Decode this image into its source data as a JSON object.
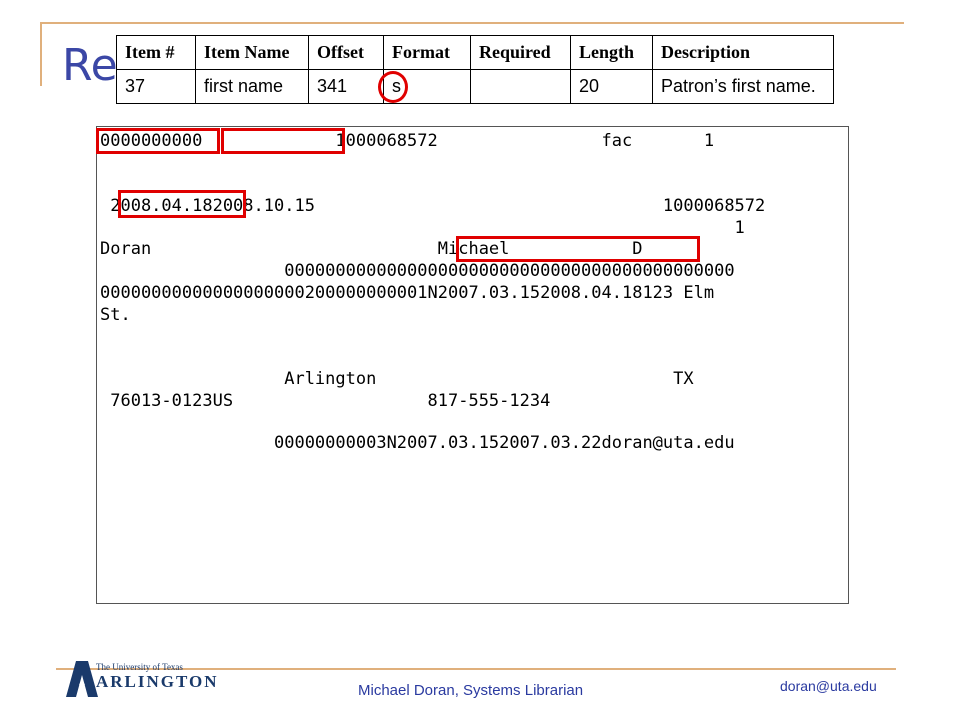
{
  "slide": {
    "title_fragment": "Re"
  },
  "spec_table": {
    "headers": [
      "Item #",
      "Item Name",
      "Offset",
      "Format",
      "Required",
      "Length",
      "Description"
    ],
    "row": [
      "37",
      "first name",
      "341",
      "s",
      "",
      "20",
      "Patron’s first name."
    ]
  },
  "record": {
    "lines": [
      "0000000000             1000068572                fac       1",
      "",
      " 2008.04.182008.10.15                                  1000068572",
      "                                                              1",
      "Doran                            Michael            D",
      "                  00000000000000000000000000000000000000000000",
      "00000000000000000000200000000001N2007.03.152008.04.18123 Elm",
      "St.",
      "",
      "",
      "                  Arlington                             TX",
      " 76013-0123US                   817-555-1234",
      "",
      "                 00000000003N2007.03.152007.03.22doran@uta.edu"
    ]
  },
  "footer": {
    "logo_line1": "The University of Texas",
    "logo_line2": "ARLINGTON",
    "logo_mark": "A",
    "presenter": "Michael Doran, Systems Librarian",
    "email": "doran@uta.edu"
  },
  "colors": {
    "highlight": "#e00000",
    "title": "#3b47a6",
    "accent_rule": "#e0b07c",
    "footer_text": "#2a3aa0"
  }
}
